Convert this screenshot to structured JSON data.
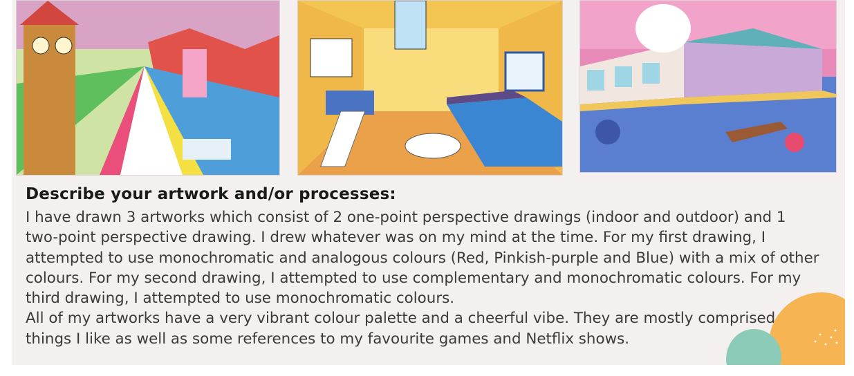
{
  "artworks": [
    {
      "icon": "drawing-outdoor-perspective"
    },
    {
      "icon": "drawing-indoor-perspective"
    },
    {
      "icon": "drawing-two-point-perspective"
    }
  ],
  "heading": "Describe your artwork and/or processes:",
  "paragraphs": [
    "I have drawn 3 artworks which consist of 2 one-point perspective drawings (indoor and outdoor) and 1 two-point perspective drawing. I drew whatever was on my mind at the time. For my first drawing, I attempted to use monochromatic and analogous colours (Red, Pinkish-purple and Blue) with a mix of other colours. For my second drawing, I attempted to use complementary and monochromatic colours. For my third drawing, I attempted to use monochromatic colours.",
    "All of my artworks have a very vibrant colour palette and a cheerful vibe. They are mostly comprised of things I like as well as some references to my favourite games and Netflix shows."
  ],
  "colors": {
    "panel": "#f4f0f0",
    "heading": "#1a1a1a",
    "body_text": "#3a3a3a",
    "blob_orange": "#f7b453",
    "blob_teal": "#8ccbb8"
  }
}
